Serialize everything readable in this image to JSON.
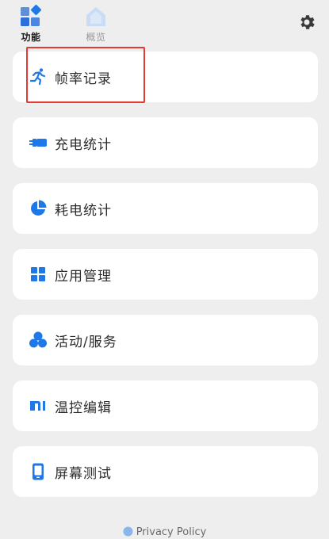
{
  "tabs": [
    {
      "label": "功能",
      "icon": "grid-diamond-icon",
      "active": true
    },
    {
      "label": "概览",
      "icon": "home-icon",
      "active": false
    }
  ],
  "settings": {
    "icon": "gear-icon"
  },
  "menu": [
    {
      "label": "帧率记录",
      "icon": "running-person-icon"
    },
    {
      "label": "充电统计",
      "icon": "charger-plug-icon"
    },
    {
      "label": "耗电统计",
      "icon": "pie-chart-icon"
    },
    {
      "label": "应用管理",
      "icon": "apps-grid-icon"
    },
    {
      "label": "活动/服务",
      "icon": "circles-icon"
    },
    {
      "label": "温控编辑",
      "icon": "mi-logo-icon"
    },
    {
      "label": "屏幕测试",
      "icon": "phone-screen-icon"
    }
  ],
  "footer": {
    "label": "Privacy Policy",
    "icon": "globe-icon"
  },
  "colors": {
    "accent": "#1e78e8",
    "background": "#eeeeef",
    "card": "#ffffff",
    "highlight": "#e53935"
  }
}
